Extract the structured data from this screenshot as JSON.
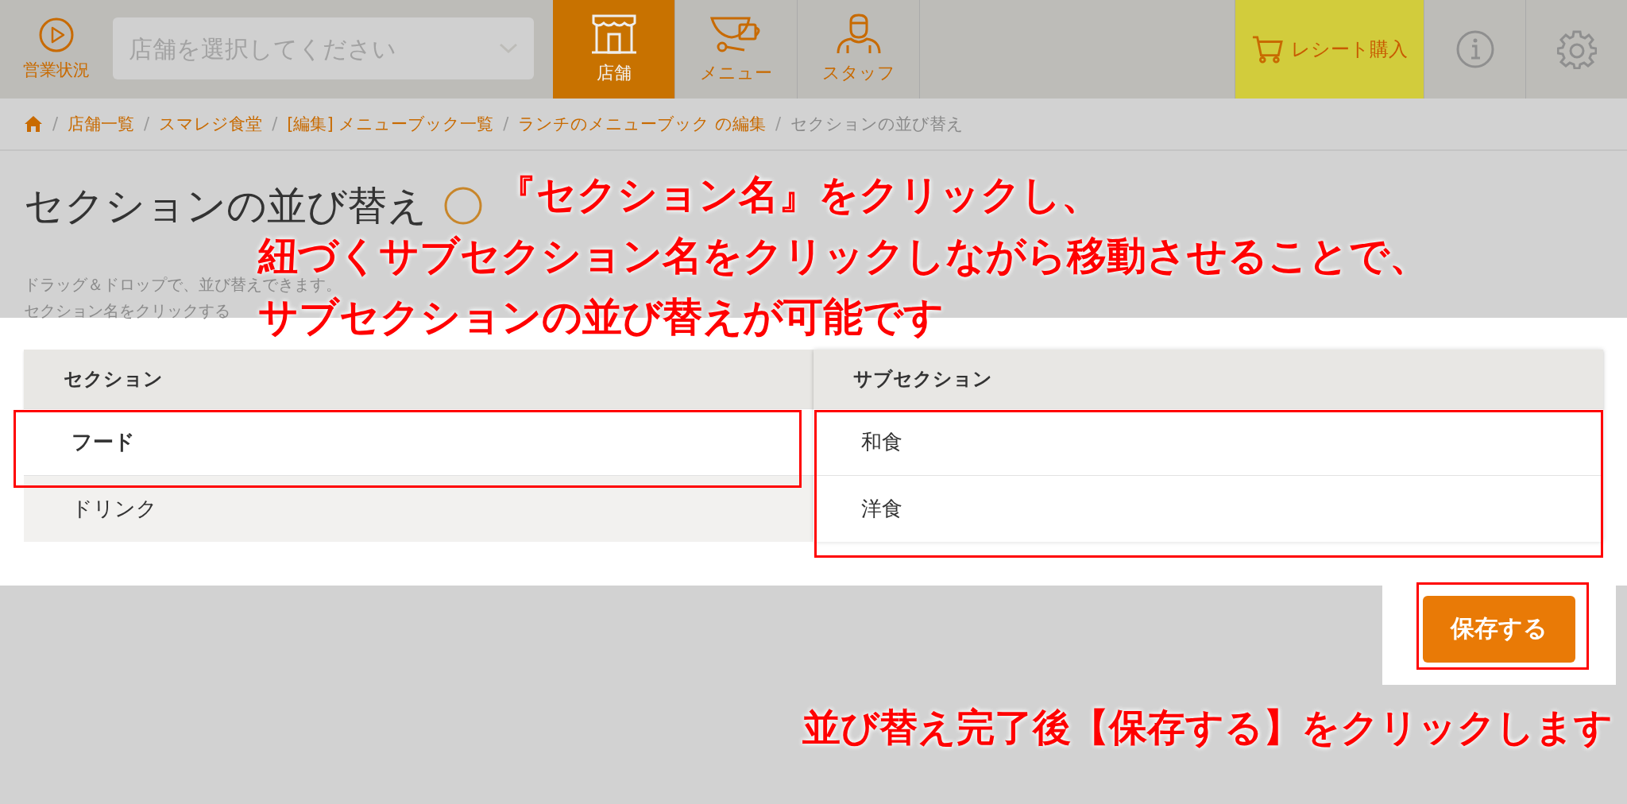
{
  "header": {
    "status": {
      "label": "営業状況"
    },
    "store_select": {
      "placeholder": "店舗を選択してください"
    },
    "nav": [
      {
        "label": "店舗",
        "selected": true,
        "kind": "store"
      },
      {
        "label": "メニュー",
        "selected": false,
        "kind": "cup"
      },
      {
        "label": "スタッフ",
        "selected": false,
        "kind": "staff"
      }
    ],
    "receipt_button": {
      "label": "レシート購入"
    }
  },
  "breadcrumb": {
    "separator": "/",
    "items": [
      {
        "label": "店舗一覧",
        "link": true
      },
      {
        "label": "スマレジ食堂",
        "link": true
      },
      {
        "label": "[編集] メニューブック一覧",
        "link": true
      },
      {
        "label": "ランチのメニューブック の編集",
        "link": true
      },
      {
        "label": "セクションの並び替え",
        "link": false
      }
    ]
  },
  "page": {
    "title": "セクションの並び替え",
    "description": [
      "ドラッグ＆ドロップで、並び替えできます。",
      "セクション名をクリックする"
    ]
  },
  "table": {
    "columns": [
      "セクション",
      "サブセクション"
    ],
    "sections": [
      {
        "name": "フード",
        "selected": true
      },
      {
        "name": "ドリンク",
        "selected": false
      }
    ],
    "subsections": [
      "和食",
      "洋食"
    ]
  },
  "save_button": {
    "label": "保存する"
  },
  "annotations": [
    {
      "lines": [
        "『セクション名』をクリックし、",
        "紐づくサブセクション名をクリックしながら移動させることで、",
        "サブセクションの並び替えが可能です"
      ]
    },
    {
      "lines": [
        "並び替え完了後【保存する】をクリックします"
      ]
    }
  ]
}
